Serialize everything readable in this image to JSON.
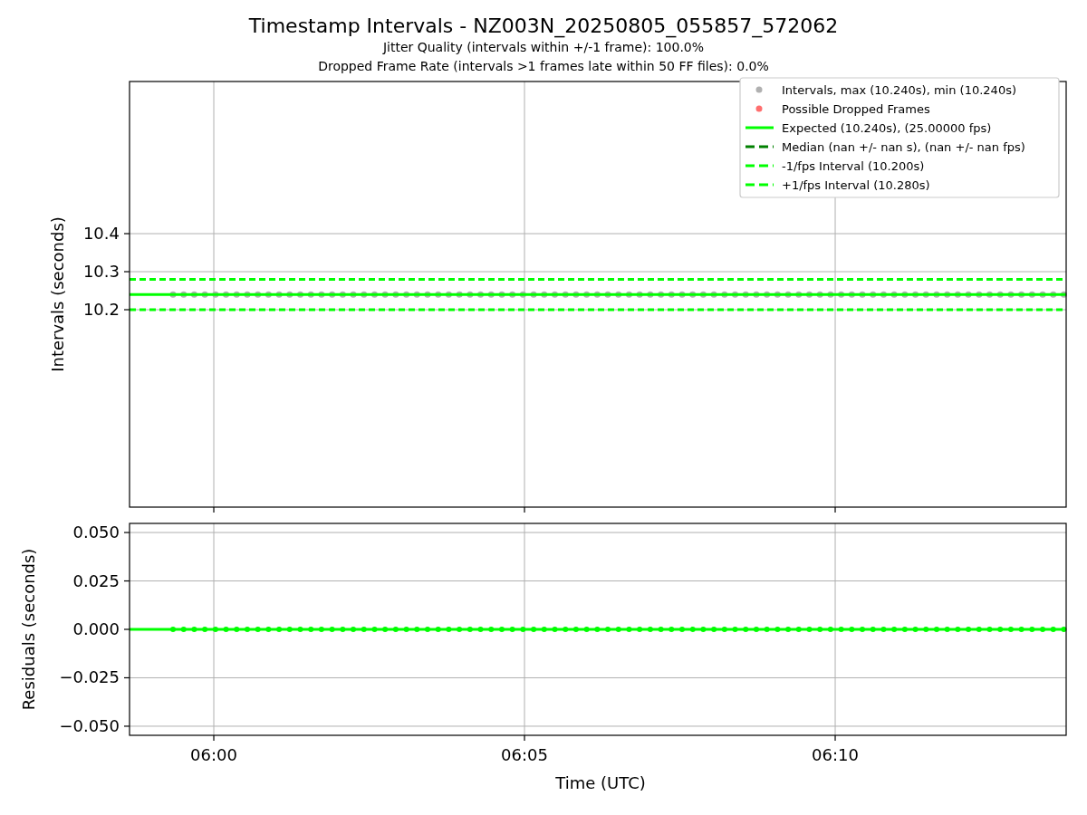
{
  "figure": {
    "title": "Timestamp Intervals - NZ003N_20250805_055857_572062",
    "subtitles": [
      "Jitter Quality (intervals within +/-1 frame): 100.0%",
      "Dropped Frame Rate (intervals >1 frames late within 50 FF files): 0.0%"
    ]
  },
  "intervals_plot": {
    "chart_data": {
      "type": "scatter",
      "ylabel": "Intervals (seconds)",
      "grid": true,
      "legend": true,
      "xlim": [
        358.644,
        373.717
      ],
      "ylim": [
        9.681,
        10.8
      ],
      "yticks": [
        {
          "value": 10.2,
          "label": "10.2"
        },
        {
          "value": 10.3,
          "label": "10.3"
        },
        {
          "value": 10.4,
          "label": "10.4"
        }
      ],
      "x": [
        359.344,
        359.515,
        359.685,
        359.856,
        360.027,
        360.197,
        360.368,
        360.539,
        360.709,
        360.88,
        361.051,
        361.221,
        361.392,
        361.563,
        361.733,
        361.904,
        362.075,
        362.245,
        362.416,
        362.587,
        362.757,
        362.928,
        363.099,
        363.269,
        363.44,
        363.611,
        363.781,
        363.952,
        364.123,
        364.293,
        364.464,
        364.635,
        364.805,
        364.976,
        365.147,
        365.317,
        365.488,
        365.659,
        365.829,
        366.0,
        366.171,
        366.341,
        366.512,
        366.683,
        366.853,
        367.024,
        367.195,
        367.365,
        367.536,
        367.707,
        367.877,
        368.048,
        368.219,
        368.389,
        368.56,
        368.731,
        368.901,
        369.072,
        369.243,
        369.413,
        369.584,
        369.755,
        369.925,
        370.096,
        370.267,
        370.437,
        370.608,
        370.779,
        370.949,
        371.12,
        371.291,
        371.461,
        371.632,
        371.803,
        371.973,
        372.144,
        372.315,
        372.485,
        372.656,
        372.827,
        372.997,
        373.168,
        373.339,
        373.509,
        373.68
      ],
      "series": [
        {
          "name": "Intervals, max (10.240s), min (10.240s)",
          "color": "#b0b0b0",
          "values": [
            10.24,
            10.24,
            10.24,
            10.24,
            10.24,
            10.24,
            10.24,
            10.24,
            10.24,
            10.24,
            10.24,
            10.24,
            10.24,
            10.24,
            10.24,
            10.24,
            10.24,
            10.24,
            10.24,
            10.24,
            10.24,
            10.24,
            10.24,
            10.24,
            10.24,
            10.24,
            10.24,
            10.24,
            10.24,
            10.24,
            10.24,
            10.24,
            10.24,
            10.24,
            10.24,
            10.24,
            10.24,
            10.24,
            10.24,
            10.24,
            10.24,
            10.24,
            10.24,
            10.24,
            10.24,
            10.24,
            10.24,
            10.24,
            10.24,
            10.24,
            10.24,
            10.24,
            10.24,
            10.24,
            10.24,
            10.24,
            10.24,
            10.24,
            10.24,
            10.24,
            10.24,
            10.24,
            10.24,
            10.24,
            10.24,
            10.24,
            10.24,
            10.24,
            10.24,
            10.24,
            10.24,
            10.24,
            10.24,
            10.24,
            10.24,
            10.24,
            10.24,
            10.24,
            10.24,
            10.24,
            10.24,
            10.24,
            10.24,
            10.24,
            10.24
          ]
        },
        {
          "name": "Possible Dropped Frames",
          "color": "#ff6e6e",
          "values": [
            null,
            null,
            null,
            null,
            null,
            null,
            null,
            null,
            null,
            null,
            null,
            null,
            null,
            null,
            null,
            null,
            null,
            null,
            null,
            null,
            null,
            null,
            null,
            null,
            null,
            null,
            null,
            null,
            null,
            null,
            null,
            null,
            null,
            null,
            null,
            null,
            null,
            null,
            null,
            null,
            null,
            null,
            null,
            null,
            null,
            null,
            null,
            null,
            null,
            null,
            null,
            null,
            null,
            null,
            null,
            null,
            null,
            null,
            null,
            null,
            null,
            null,
            null,
            null,
            null,
            null,
            null,
            null,
            null,
            null,
            null,
            null,
            null,
            null,
            null,
            null,
            null,
            null,
            null,
            null,
            null,
            null,
            null,
            null,
            null
          ]
        }
      ],
      "ref_lines": [
        {
          "axis": "y",
          "value": 10.24,
          "label": "Expected (10.240s), (25.00000 fps)",
          "color": "#00ff00"
        },
        {
          "axis": "y",
          "value": null,
          "label": "Median (nan +/- nan s), (nan +/- nan fps)",
          "color": "#008000"
        },
        {
          "axis": "y",
          "value": 10.2,
          "label": "-1/fps Interval (10.200s)",
          "color": "#00ff00"
        },
        {
          "axis": "y",
          "value": 10.28,
          "label": "+1/fps Interval (10.280s)",
          "color": "#00ff00"
        }
      ]
    }
  },
  "residuals_plot": {
    "chart_data": {
      "type": "scatter",
      "xlabel": "Time (UTC)",
      "ylabel": "Residuals (seconds)",
      "grid": true,
      "xlim": [
        358.644,
        373.717
      ],
      "ylim": [
        -0.0547,
        0.0547
      ],
      "xticks": [
        {
          "value": 360,
          "label": "06:00"
        },
        {
          "value": 365,
          "label": "06:05"
        },
        {
          "value": 370,
          "label": "06:10"
        }
      ],
      "yticks": [
        {
          "value": 0.05,
          "label": "0.050"
        },
        {
          "value": 0.025,
          "label": "0.025"
        },
        {
          "value": 0,
          "label": "0.000"
        },
        {
          "value": -0.025,
          "label": "−0.025"
        },
        {
          "value": -0.05,
          "label": "−0.050"
        }
      ],
      "x": [
        359.344,
        359.515,
        359.685,
        359.856,
        360.027,
        360.197,
        360.368,
        360.539,
        360.709,
        360.88,
        361.051,
        361.221,
        361.392,
        361.563,
        361.733,
        361.904,
        362.075,
        362.245,
        362.416,
        362.587,
        362.757,
        362.928,
        363.099,
        363.269,
        363.44,
        363.611,
        363.781,
        363.952,
        364.123,
        364.293,
        364.464,
        364.635,
        364.805,
        364.976,
        365.147,
        365.317,
        365.488,
        365.659,
        365.829,
        366.0,
        366.171,
        366.341,
        366.512,
        366.683,
        366.853,
        367.024,
        367.195,
        367.365,
        367.536,
        367.707,
        367.877,
        368.048,
        368.219,
        368.389,
        368.56,
        368.731,
        368.901,
        369.072,
        369.243,
        369.413,
        369.584,
        369.755,
        369.925,
        370.096,
        370.267,
        370.437,
        370.608,
        370.779,
        370.949,
        371.12,
        371.291,
        371.461,
        371.632,
        371.803,
        371.973,
        372.144,
        372.315,
        372.485,
        372.656,
        372.827,
        372.997,
        373.168,
        373.339,
        373.509,
        373.68
      ],
      "series": [
        {
          "color": "#00ff00",
          "values": [
            0,
            0,
            0,
            0,
            0,
            0,
            0,
            0,
            0,
            0,
            0,
            0,
            0,
            0,
            0,
            0,
            0,
            0,
            0,
            0,
            0,
            0,
            0,
            0,
            0,
            0,
            0,
            0,
            0,
            0,
            0,
            0,
            0,
            0,
            0,
            0,
            0,
            0,
            0,
            0,
            0,
            0,
            0,
            0,
            0,
            0,
            0,
            0,
            0,
            0,
            0,
            0,
            0,
            0,
            0,
            0,
            0,
            0,
            0,
            0,
            0,
            0,
            0,
            0,
            0,
            0,
            0,
            0,
            0,
            0,
            0,
            0,
            0,
            0,
            0,
            0,
            0,
            0,
            0,
            0,
            0,
            0,
            0,
            0,
            0
          ]
        }
      ],
      "ref_lines": [
        {
          "axis": "y",
          "value": 0,
          "color": "#00ff00"
        }
      ]
    }
  }
}
